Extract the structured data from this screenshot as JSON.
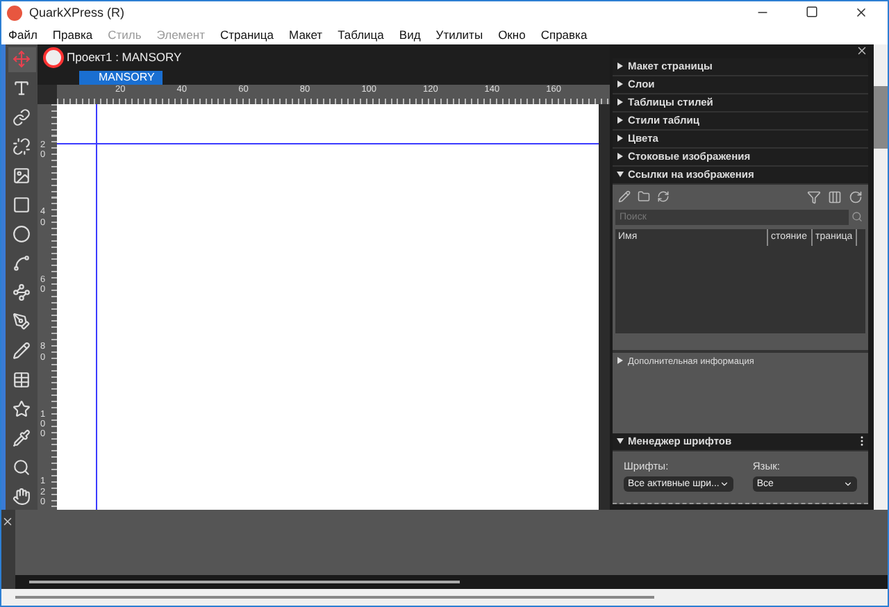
{
  "window": {
    "title": "QuarkXPress (R)"
  },
  "menu": [
    {
      "label": "Файл",
      "disabled": false
    },
    {
      "label": "Правка",
      "disabled": false
    },
    {
      "label": "Стиль",
      "disabled": true
    },
    {
      "label": "Элемент",
      "disabled": true
    },
    {
      "label": "Страница",
      "disabled": false
    },
    {
      "label": "Макет",
      "disabled": false
    },
    {
      "label": "Таблица",
      "disabled": false
    },
    {
      "label": "Вид",
      "disabled": false
    },
    {
      "label": "Утилиты",
      "disabled": false
    },
    {
      "label": "Окно",
      "disabled": false
    },
    {
      "label": "Справка",
      "disabled": false
    }
  ],
  "tools": [
    {
      "kind": "move",
      "selected": true
    },
    {
      "kind": "text",
      "selected": false
    },
    {
      "kind": "link",
      "selected": false
    },
    {
      "kind": "unlink",
      "selected": false
    },
    {
      "kind": "picture",
      "selected": false
    },
    {
      "kind": "rect",
      "selected": false
    },
    {
      "kind": "ellipse",
      "selected": false
    },
    {
      "kind": "line",
      "selected": false
    },
    {
      "kind": "nodes",
      "selected": false
    },
    {
      "kind": "pen",
      "selected": false
    },
    {
      "kind": "pencil",
      "selected": false
    },
    {
      "kind": "table",
      "selected": false
    },
    {
      "kind": "star",
      "selected": false
    },
    {
      "kind": "eyedropper",
      "selected": false
    },
    {
      "kind": "zoom",
      "selected": false
    },
    {
      "kind": "hand",
      "selected": false
    }
  ],
  "document": {
    "title": "Проект1 : MANSORY",
    "tabs": [
      {
        "label": "MANSORY",
        "selected": true
      }
    ],
    "hruler": [
      "20",
      "40",
      "60",
      "80",
      "100",
      "120",
      "140",
      "160"
    ],
    "vruler": [
      "20",
      "40",
      "60",
      "80",
      "100",
      "120"
    ]
  },
  "panels": [
    {
      "title": "Макет страницы",
      "expanded": false
    },
    {
      "title": "Слои",
      "expanded": false
    },
    {
      "title": "Таблицы стилей",
      "expanded": false
    },
    {
      "title": "Стили таблиц",
      "expanded": false
    },
    {
      "title": "Цвета",
      "expanded": false
    },
    {
      "title": "Стоковые изображения",
      "expanded": false
    },
    {
      "title": "Ссылки на изображения",
      "expanded": true
    }
  ],
  "image_links": {
    "search": {
      "placeholder": "Поиск"
    },
    "columns": [
      "Имя",
      "стояние",
      "траница"
    ],
    "more_info": {
      "title": "Дополнительная информация",
      "expanded": false
    }
  },
  "font_manager": {
    "title": "Менеджер шрифтов",
    "expanded": true,
    "fonts_label": "Шрифты:",
    "fonts_value": "Все активные шри...",
    "language_label": "Язык:",
    "language_value": "Все"
  }
}
